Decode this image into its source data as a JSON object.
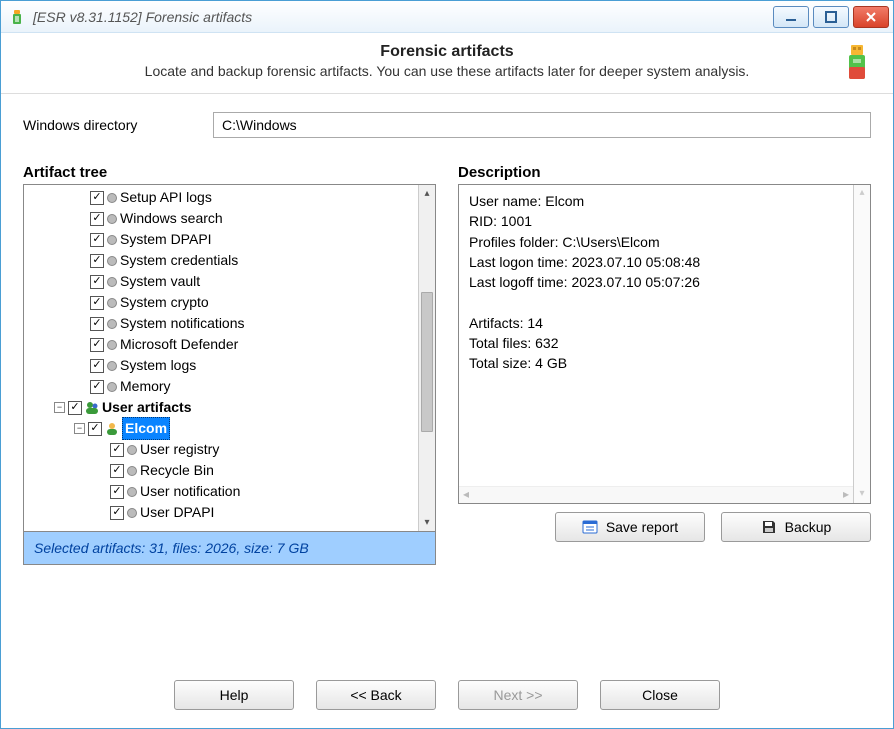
{
  "window": {
    "title": "[ESR v8.31.1152]  Forensic artifacts"
  },
  "header": {
    "title": "Forensic artifacts",
    "desc": "Locate and backup forensic artifacts. You can use these artifacts later for deeper system analysis."
  },
  "dir": {
    "label": "Windows directory",
    "value": "C:\\Windows"
  },
  "labels": {
    "tree": "Artifact tree",
    "desc": "Description",
    "save_report": "Save report",
    "backup": "Backup",
    "help": "Help",
    "back": "<< Back",
    "next": "Next >>",
    "close": "Close"
  },
  "tree": {
    "sys": [
      "Setup API logs",
      "Windows search",
      "System DPAPI",
      "System credentials",
      "System vault",
      "System crypto",
      "System notifications",
      "Microsoft Defender",
      "System logs",
      "Memory"
    ],
    "user_heading": "User artifacts",
    "selected_user": "Elcom",
    "user_items": [
      "User registry",
      "Recycle Bin",
      "User notification",
      "User DPAPI"
    ]
  },
  "description": {
    "line1": "User name: Elcom",
    "line2": "RID: 1001",
    "line3": "Profiles folder: C:\\Users\\Elcom",
    "line4": "Last logon time: 2023.07.10 05:08:48",
    "line5": "Last logoff time: 2023.07.10 05:07:26",
    "line6": "",
    "line7": "Artifacts: 14",
    "line8": "Total files: 632",
    "line9": "Total size: 4 GB"
  },
  "status": "Selected artifacts: 31, files: 2026, size: 7 GB"
}
